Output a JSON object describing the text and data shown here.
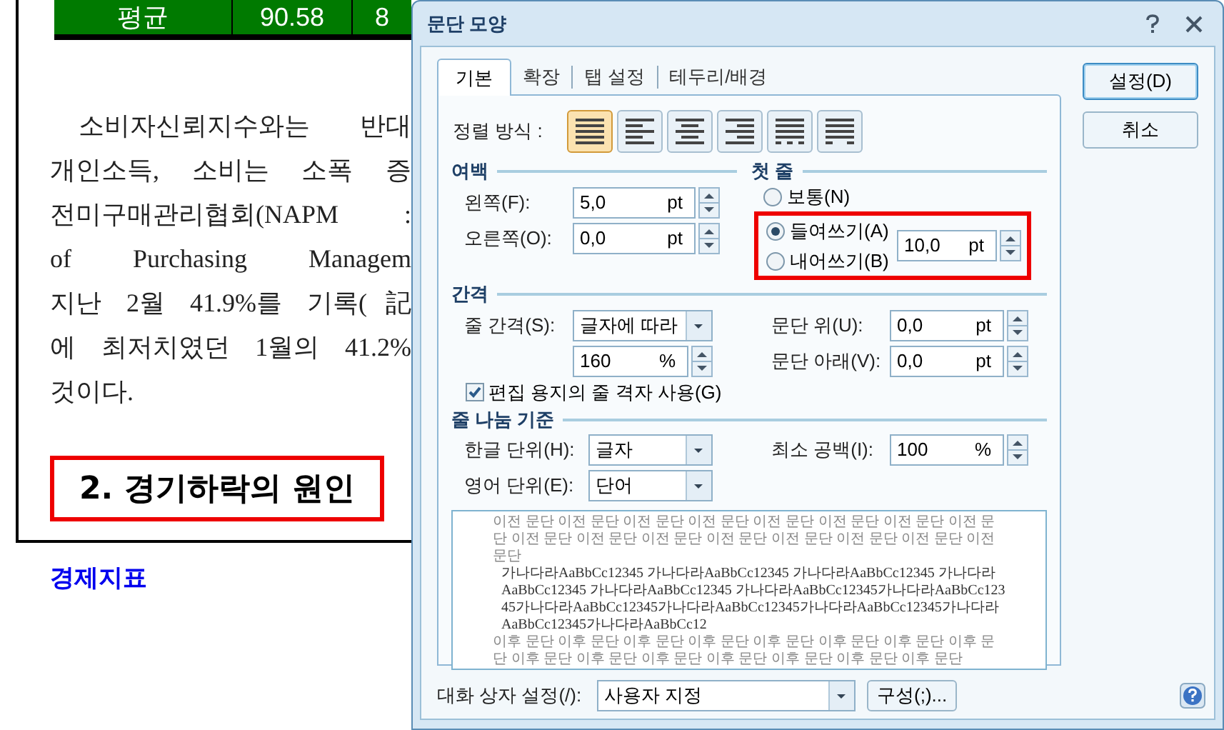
{
  "document": {
    "table_row": [
      "평균",
      "90.58",
      "8"
    ],
    "paragraph_lines": [
      "소비자신뢰지수와는 반대",
      "개인소득, 소비는 소폭 증",
      "전미구매관리협회(NAPM :",
      "of Purchasing Managem",
      "지난 2월 41.9%를 기록(記",
      "에 최저치였던 1월의 41.2%",
      "것이다."
    ],
    "heading": {
      "text": "2. 경기하락의 원인",
      "highlighted": true
    },
    "caption": "경제지표"
  },
  "dialog": {
    "title": "문단 모양",
    "tabs": [
      {
        "label": "기본",
        "selected": true
      },
      {
        "label": "확장",
        "selected": false
      },
      {
        "label": "탭 설정",
        "selected": false
      },
      {
        "label": "테두리/배경",
        "selected": false
      }
    ],
    "alignment": {
      "label": "정렬 방식 :",
      "options": [
        {
          "kind": "justify",
          "selected": true
        },
        {
          "kind": "left",
          "selected": false
        },
        {
          "kind": "center",
          "selected": false
        },
        {
          "kind": "right",
          "selected": false
        },
        {
          "kind": "distribute",
          "selected": false
        },
        {
          "kind": "divide",
          "selected": false
        }
      ]
    },
    "margin": {
      "title": "여백",
      "fields": [
        {
          "label": "왼쪽(F):",
          "value": "5,0",
          "unit": "pt"
        },
        {
          "label": "오른쪽(O):",
          "value": "0,0",
          "unit": "pt"
        }
      ]
    },
    "first_line": {
      "title": "첫 줄",
      "highlighted": true,
      "options": [
        {
          "label": "보통(N)",
          "selected": false
        },
        {
          "label": "들여쓰기(A)",
          "selected": true
        },
        {
          "label": "내어쓰기(B)",
          "selected": false
        }
      ],
      "value": "10,0",
      "unit": "pt"
    },
    "spacing": {
      "title": "간격",
      "line_spacing": {
        "label": "줄 간격(S):",
        "type": "글자에 따라",
        "value": "160",
        "unit": "%"
      },
      "fields": [
        {
          "label": "문단 위(U):",
          "value": "0,0",
          "unit": "pt"
        },
        {
          "label": "문단 아래(V):",
          "value": "0,0",
          "unit": "pt"
        }
      ]
    },
    "grid_option": {
      "label": "편집 용지의 줄 격자 사용(G)",
      "checked": true
    },
    "line_break": {
      "title": "줄 나눔 기준",
      "korean": {
        "label": "한글 단위(H):",
        "value": "글자"
      },
      "english": {
        "label": "영어 단위(E):",
        "value": "단어"
      },
      "min_space": {
        "label": "최소 공백(I):",
        "value": "100",
        "unit": "%"
      }
    },
    "preview": {
      "before": "이전 문단 이전 문단 이전 문단 이전 문단 이전 문단 이전 문단 이전 문단 이전 문단 이전 문단 이전 문단 이전 문단 이전 문단 이전 문단 이전 문단 이전 문단 이전 문단",
      "current": "가나다라AaBbCc12345 가나다라AaBbCc12345 가나다라AaBbCc12345 가나다라AaBbCc12345 가나다라AaBbCc12345 가나다라AaBbCc12345가나다라AaBbCc12345가나다라AaBbCc12345가나다라AaBbCc12345가나다라AaBbCc12345가나다라AaBbCc12345가나다라AaBbCc12",
      "after": "이후 문단 이후 문단 이후 문단 이후 문단 이후 문단 이후 문단 이후 문단 이후 문단 이후 문단 이후 문단 이후 문단 이후 문단 이후 문단 이후 문단 이후 문단"
    },
    "buttons": [
      {
        "label": "설정(D)",
        "default": true
      },
      {
        "label": "취소",
        "default": false
      }
    ],
    "footer": {
      "label": "대화 상자 설정(/):",
      "value": "사용자 지정",
      "button": "구성(;)..."
    }
  }
}
